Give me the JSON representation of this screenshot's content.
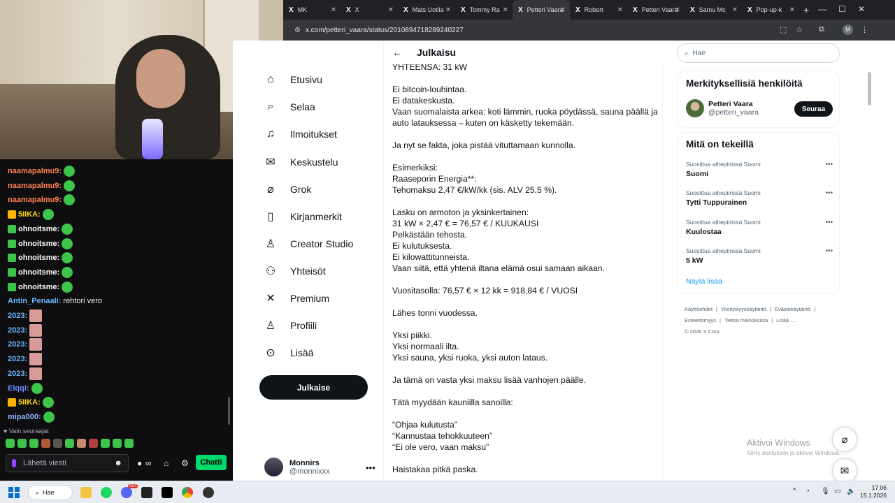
{
  "colors": {
    "x_black": "#0f1419",
    "link_blue": "#1d9bf0",
    "twitch_green": "#00d96b",
    "chat_bg": "#0e0e10"
  },
  "webcam": {
    "icon": "webcam-feed"
  },
  "chat": {
    "lines": [
      {
        "user": "naamapalmu9:",
        "color": "#ff7f50",
        "emote": "green",
        "badge": ""
      },
      {
        "user": "naamapalmu9:",
        "color": "#ff7f50",
        "emote": "green",
        "badge": ""
      },
      {
        "user": "naamapalmu9:",
        "color": "#ff7f50",
        "emote": "green",
        "badge": ""
      },
      {
        "user": "5IIKA:",
        "color": "#ffd700",
        "emote": "green",
        "badge": "crown"
      },
      {
        "user": "ohnoitsme:",
        "color": "#ffffff",
        "emote": "green",
        "badge": "green"
      },
      {
        "user": "ohnoitsme:",
        "color": "#ffffff",
        "emote": "green",
        "badge": "green"
      },
      {
        "user": "ohnoitsme:",
        "color": "#ffffff",
        "emote": "green",
        "badge": "green"
      },
      {
        "user": "ohnoitsme:",
        "color": "#ffffff",
        "emote": "green",
        "badge": "green"
      },
      {
        "user": "ohnoitsme:",
        "color": "#ffffff",
        "emote": "green",
        "badge": "green"
      },
      {
        "user": "Antin_Penaali:",
        "color": "#6bb6ff",
        "message": "rehtori vero",
        "badge": ""
      },
      {
        "user": "2023:",
        "color": "#6bb6ff",
        "emote": "pink",
        "badge": ""
      },
      {
        "user": "2023:",
        "color": "#6bb6ff",
        "emote": "pink",
        "badge": ""
      },
      {
        "user": "2023:",
        "color": "#6bb6ff",
        "emote": "pink",
        "badge": ""
      },
      {
        "user": "2023:",
        "color": "#6bb6ff",
        "emote": "pink",
        "badge": ""
      },
      {
        "user": "2023:",
        "color": "#6bb6ff",
        "emote": "pink",
        "badge": ""
      },
      {
        "user": "Elqqi:",
        "color": "#6b8cff",
        "emote": "green",
        "badge": ""
      },
      {
        "user": "5IIKA:",
        "color": "#ffd700",
        "emote": "green",
        "badge": "crown"
      },
      {
        "user": "mipa000:",
        "color": "#8fb4ff",
        "emote": "green",
        "badge": ""
      }
    ],
    "followers_only": "Vain seuraajat",
    "input_placeholder": "Lähetä viesti",
    "points": "∞",
    "send_label": "Chatti"
  },
  "browser": {
    "tabs": [
      {
        "title": "MK",
        "active": false
      },
      {
        "title": "X",
        "active": false
      },
      {
        "title": "Mats Uotila",
        "active": false
      },
      {
        "title": "Tommy Ra",
        "active": false
      },
      {
        "title": "Petteri Vaara",
        "active": true
      },
      {
        "title": "Robert",
        "active": false
      },
      {
        "title": "Petteri Vaara",
        "active": false
      },
      {
        "title": "Samu Mc",
        "active": false
      },
      {
        "title": "Pop-up-k",
        "active": false
      }
    ],
    "url": "x.com/petteri_vaara/status/2010894718289240227"
  },
  "x": {
    "nav": [
      {
        "label": "Etusivu",
        "icon": "home-icon"
      },
      {
        "label": "Selaa",
        "icon": "search-icon"
      },
      {
        "label": "Ilmoitukset",
        "icon": "bell-icon"
      },
      {
        "label": "Keskustelu",
        "icon": "mail-icon"
      },
      {
        "label": "Grok",
        "icon": "grok-icon"
      },
      {
        "label": "Kirjanmerkit",
        "icon": "bookmark-icon"
      },
      {
        "label": "Creator Studio",
        "icon": "flask-icon"
      },
      {
        "label": "Yhteisöt",
        "icon": "people-icon"
      },
      {
        "label": "Premium",
        "icon": "x-logo-icon"
      },
      {
        "label": "Profiili",
        "icon": "person-icon"
      },
      {
        "label": "Lisää",
        "icon": "more-circle-icon"
      }
    ],
    "post_button": "Julkaise",
    "account": {
      "name": "Monnirs",
      "handle": "@monnixxx"
    },
    "header_title": "Julkaisu",
    "tweet_lines": [
      "YHTEENSÄ: 31 kW",
      "",
      "Ei bitcoin-louhintaa.",
      "Ei datakeskusta.",
      "Vaan suomalaista arkea: koti lämmin, ruoka pöydässä, sauna päällä ja",
      "auto latauksessa – kuten on käsketty tekemään.",
      "",
      "Ja nyt se fakta, joka pistää vituttamaan kunnolla.",
      "",
      "Esimerkiksi:",
      "Raaseporin Energia**:",
      "Tehomaksu 2,47 €/kW/kk (sis. ALV 25,5 %).",
      "",
      "Lasku on armoton ja yksinkertainen:",
      "31 kW × 2,47 € = 76,57 € / KUUKAUSI",
      "Pelkästään tehosta.",
      "Ei kulutuksesta.",
      "Ei kilowattitunneista.",
      "Vaan siitä, että yhtenä iltana elämä osui samaan aikaan.",
      "",
      "Vuositasolla: 76,57 € × 12 kk = 918,84 € / VUOSI",
      "",
      "Lähes tonni vuodessa.",
      "",
      "Yksi piikki.",
      "Yksi normaali ilta.",
      "Yksi sauna, yksi ruoka, yksi auton lataus.",
      "",
      "Ja tämä on vasta yksi maksu lisää vanhojen päälle.",
      "",
      "Tätä myydään kauniilla sanoilla:",
      "",
      "“Ohjaa kulutusta”",
      "“Kannustaa tehokkuuteen”",
      "“Ei ole vero, vaan maksu”",
      "",
      "Haistakaa pitkä paska."
    ],
    "search_placeholder": "Hae",
    "who_title": "Merkityksellisiä henkilöitä",
    "who": {
      "name": "Petteri Vaara",
      "handle": "@petteri_vaara",
      "button": "Seuraa"
    },
    "trends_title": "Mitä on tekeillä",
    "trends": [
      {
        "context": "Suosittua aihepiirissä Suomi",
        "name": "Suomi"
      },
      {
        "context": "Suosittua aihepiirissä Suomi",
        "name": "Tytti Tuppurainen"
      },
      {
        "context": "Suosittua aihepiirissä Suomi",
        "name": "Kuulostaa"
      },
      {
        "context": "Suosittua aihepiirissä Suomi",
        "name": "5 kW"
      }
    ],
    "show_more": "Näytä lisää",
    "footer": [
      "Käyttöehdot",
      "|",
      "Yksityisyyskäytäntö",
      "|",
      "Evästekäytäntö",
      "|",
      "Esteettömyys",
      "|",
      "Tietoa mainoksista",
      "|",
      "Lisää …",
      "© 2026 X Corp."
    ],
    "activate_title": "Aktivoi Windows",
    "activate_sub": "Siirry asetuksiin ja aktivoi Windows."
  },
  "taskbar": {
    "search": "Hae",
    "time": "17.06",
    "date": "15.1.2026",
    "notification_badge": "99+"
  }
}
